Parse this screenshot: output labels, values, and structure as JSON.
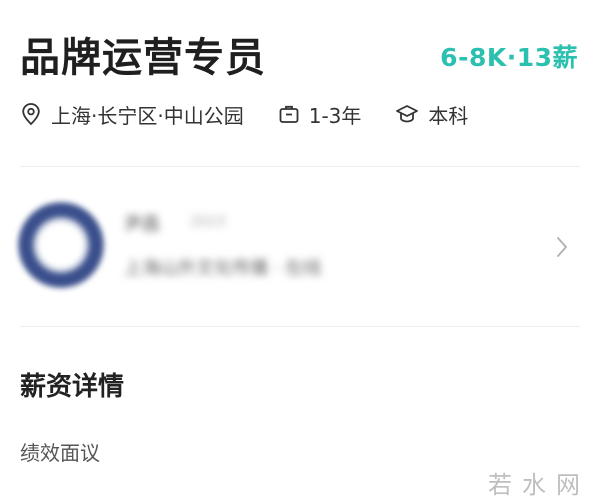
{
  "job": {
    "title": "品牌运营专员",
    "salary": "6-8K·13薪"
  },
  "meta": {
    "location": "上海·长宁区·中山公园",
    "location_icon": "location-pin-icon",
    "experience": "1-3年",
    "experience_icon": "briefcase-icon",
    "education": "本科",
    "education_icon": "graduation-cap-icon"
  },
  "company": {
    "name": "尹昌",
    "sub": "2023",
    "desc": "上海山外文化传播 · 在线",
    "chevron_icon": "chevron-right-icon"
  },
  "salary_details": {
    "heading": "薪资详情",
    "body": "绩效面议"
  },
  "watermark": "若水网",
  "colors": {
    "accent": "#2cc0b0",
    "title": "#1f1f1f",
    "divider": "#eeeeee"
  }
}
